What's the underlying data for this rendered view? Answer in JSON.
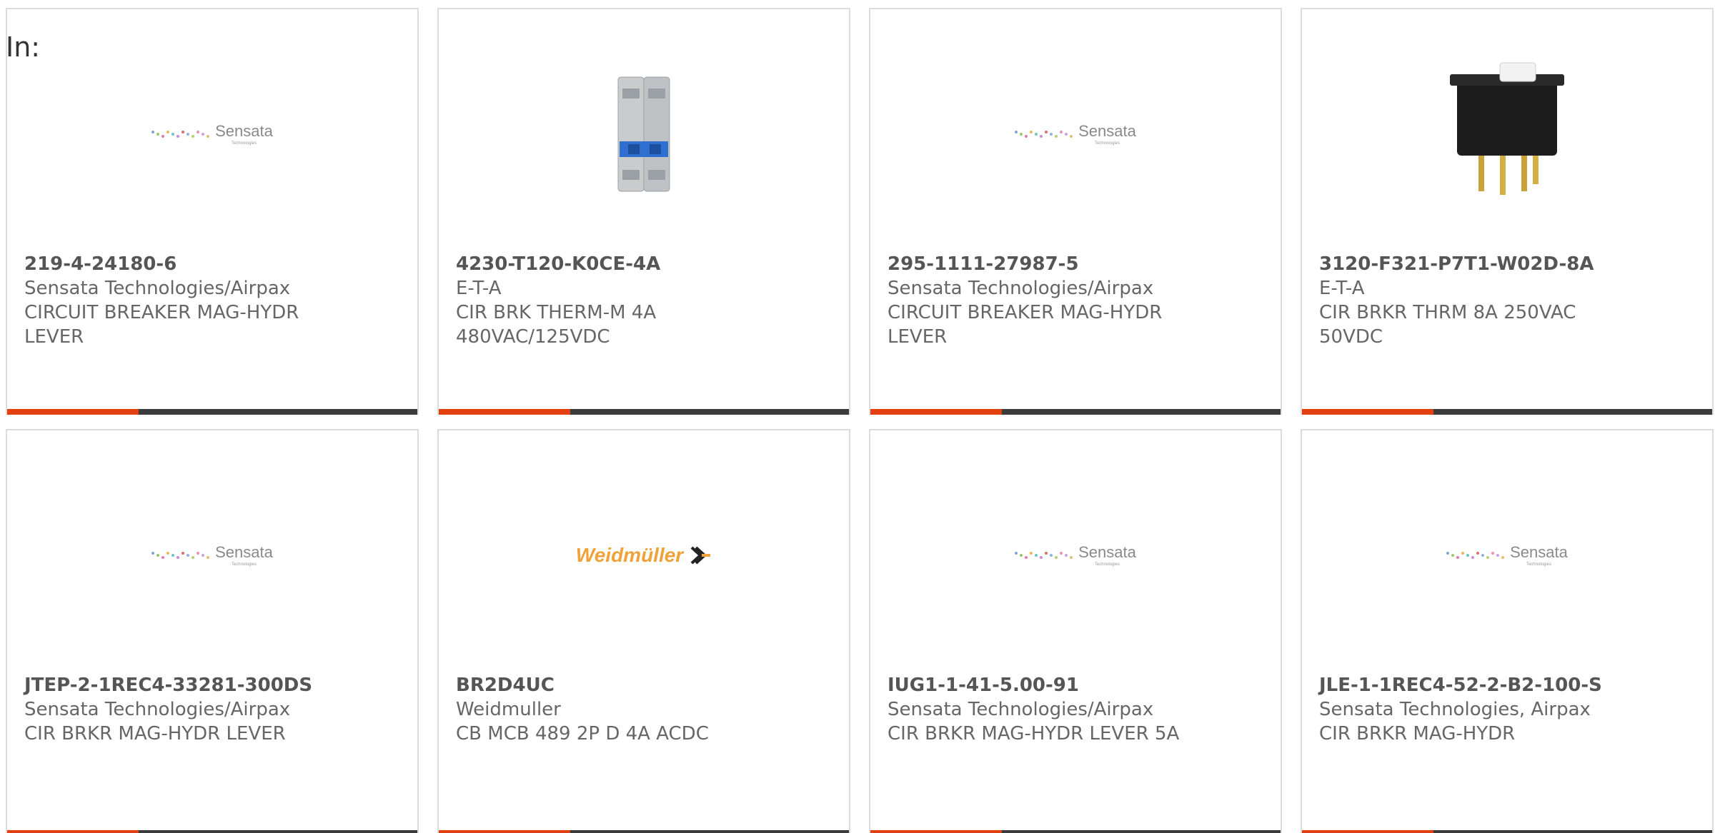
{
  "filter": {
    "label": "In:"
  },
  "products": [
    {
      "part_number": "219-4-24180-6",
      "manufacturer": "Sensata Technologies/Airpax",
      "description_lines": [
        "CIRCUIT BREAKER MAG-HYDR",
        "LEVER"
      ],
      "image": "sensata-logo",
      "logo_name": "Sensata",
      "logo_sub": "Technologies"
    },
    {
      "part_number": "4230-T120-K0CE-4A",
      "manufacturer": "E-T-A",
      "description_lines": [
        "CIR BRK THERM-M 4A",
        "480VAC/125VDC"
      ],
      "image": "din-rail-breaker-photo"
    },
    {
      "part_number": "295-1111-27987-5",
      "manufacturer": "Sensata Technologies/Airpax",
      "description_lines": [
        "CIRCUIT BREAKER MAG-HYDR",
        "LEVER"
      ],
      "image": "sensata-logo",
      "logo_name": "Sensata",
      "logo_sub": "Technologies"
    },
    {
      "part_number": "3120-F321-P7T1-W02D-8A",
      "manufacturer": "E-T-A",
      "description_lines": [
        "CIR BRKR THRM 8A 250VAC",
        "50VDC"
      ],
      "image": "rocker-switch-breaker-photo"
    },
    {
      "part_number": "JTEP-2-1REC4-33281-300DS",
      "manufacturer": "Sensata Technologies/Airpax",
      "description_lines": [
        "CIR BRKR MAG-HYDR LEVER"
      ],
      "image": "sensata-logo",
      "logo_name": "Sensata",
      "logo_sub": "Technologies"
    },
    {
      "part_number": "BR2D4UC",
      "manufacturer": "Weidmuller",
      "description_lines": [
        "CB MCB 489 2P D 4A ACDC"
      ],
      "image": "weidmuller-logo",
      "logo_name": "Weidmüller"
    },
    {
      "part_number": "IUG1-1-41-5.00-91",
      "manufacturer": "Sensata Technologies/Airpax",
      "description_lines": [
        "CIR BRKR MAG-HYDR LEVER 5A"
      ],
      "image": "sensata-logo",
      "logo_name": "Sensata",
      "logo_sub": "Technologies"
    },
    {
      "part_number": "JLE-1-1REC4-52-2-B2-100-S",
      "manufacturer": "Sensata Technologies, Airpax",
      "description_lines": [
        "CIR BRKR MAG-HYDR"
      ],
      "image": "sensata-logo",
      "logo_name": "Sensata",
      "logo_sub": "Technologies"
    }
  ],
  "colors": {
    "accent": "#e2400f",
    "bar": "#3b3b3b",
    "border": "#dcdcdc",
    "weidmuller": "#f0a23a"
  }
}
